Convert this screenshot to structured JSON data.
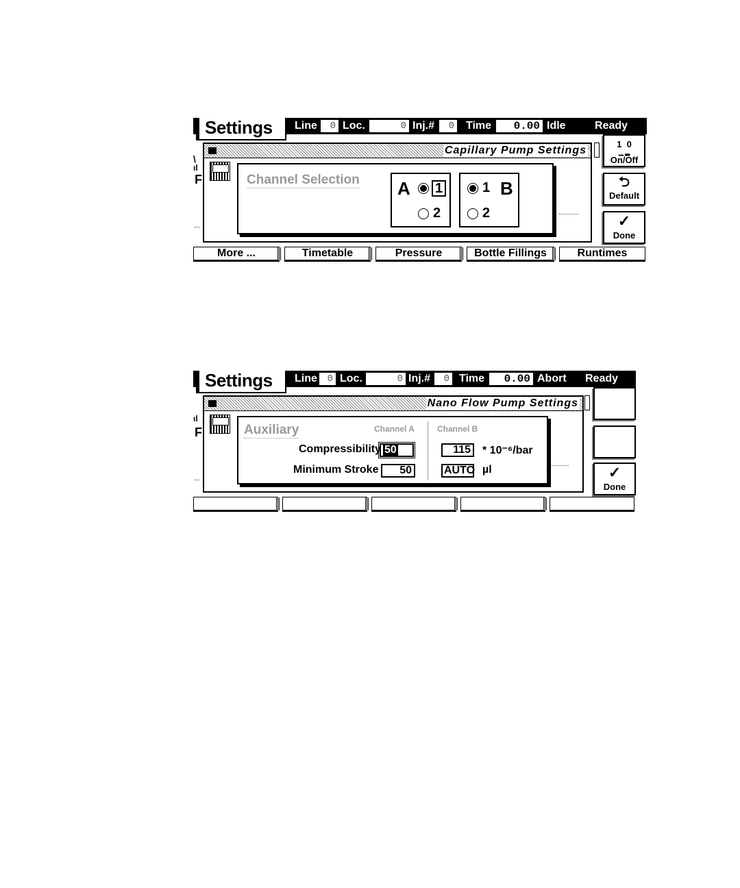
{
  "screen1": {
    "title": "Settings",
    "status": {
      "line_label": "Line",
      "line_value": "0",
      "loc_label": "Loc.",
      "loc_value": "0",
      "inj_label": "Inj.#",
      "inj_value": "0",
      "time_label": "Time",
      "time_value": "0.00",
      "state": "Idle",
      "ready": "Ready"
    },
    "dialog_title": "Capillary Pump Settings",
    "section_heading": "Channel Selection",
    "channel_a": {
      "letter": "A",
      "opt1": "1",
      "opt2": "2",
      "selected": "1"
    },
    "channel_b": {
      "letter": "B",
      "opt1": "1",
      "opt2": "2",
      "selected": "1"
    },
    "side_buttons": {
      "onoff_top": "1  0",
      "onoff_label": "On/Off",
      "default_label": "Default",
      "done_label": "Done"
    },
    "softkeys": [
      "More ...",
      "Timetable",
      "Pressure",
      "Bottle Fillings",
      "Runtimes"
    ]
  },
  "screen2": {
    "title": "Settings",
    "status": {
      "line_label": "Line",
      "line_value": "0",
      "loc_label": "Loc.",
      "loc_value": "0",
      "inj_label": "Inj.#",
      "inj_value": "0",
      "time_label": "Time",
      "time_value": "0.00",
      "state": "Abort",
      "ready": "Ready"
    },
    "dialog_title": "Nano Flow Pump Settings",
    "section_heading": "Auxiliary",
    "channel_a_header": "Channel A",
    "channel_b_header": "Channel B",
    "compressibility_label": "Compressibility",
    "compressibility_a": "50",
    "compressibility_b": "115",
    "compressibility_unit": "* 10⁻⁶/bar",
    "min_stroke_label": "Minimum Stroke",
    "min_stroke_a": "50",
    "min_stroke_b": "AUTO",
    "min_stroke_unit": "µl",
    "done_label": "Done",
    "softkeys": [
      "",
      "",
      "",
      "",
      ""
    ]
  }
}
